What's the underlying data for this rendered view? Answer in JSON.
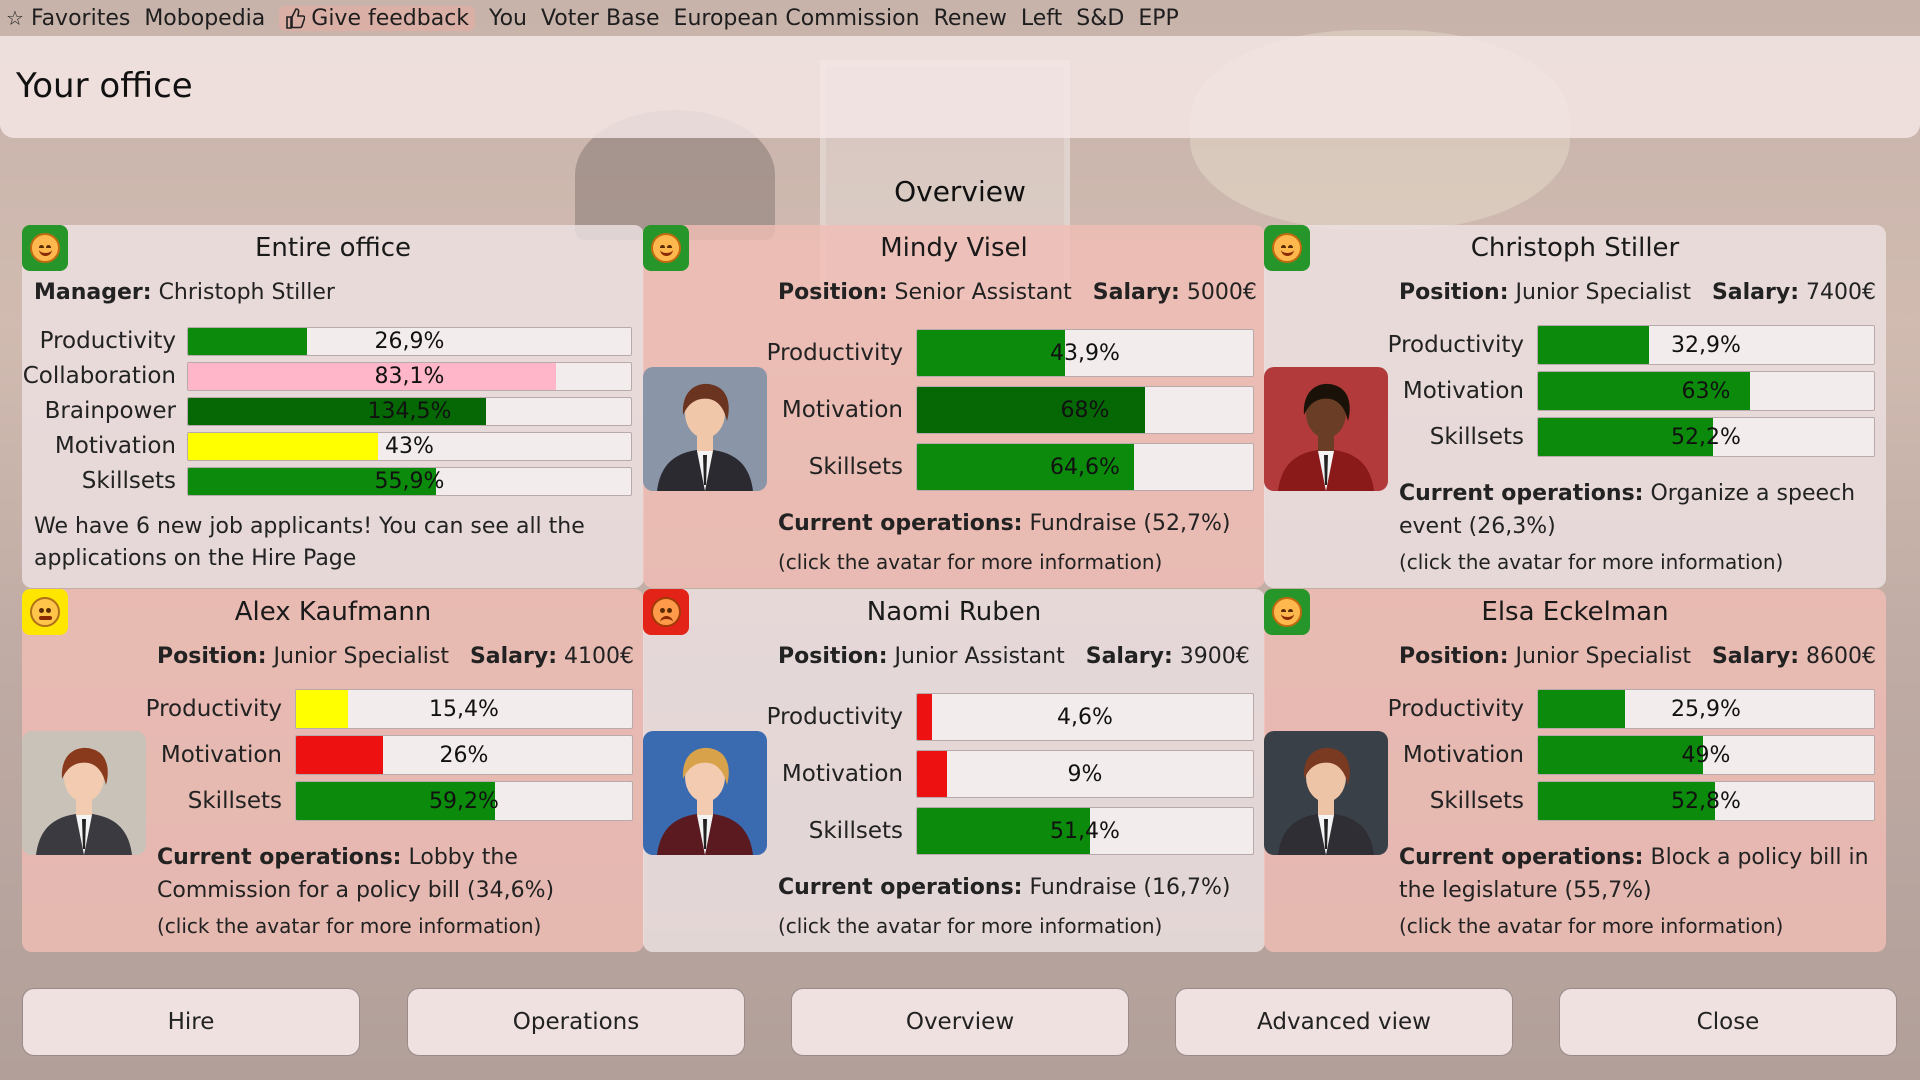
{
  "topbar": {
    "items": [
      "Favorites",
      "Mobopedia",
      "Give feedback",
      "You",
      "Voter Base",
      "European Commission",
      "Renew",
      "Left",
      "S&D",
      "EPP"
    ]
  },
  "title": "Your office",
  "overview_heading": "Overview",
  "colors": {
    "green": "#0b8a0b",
    "dark_green": "#056805",
    "yellow": "#ffff00",
    "red": "#ee1111",
    "pink": "#ffb6c8",
    "mood_green": "#27962a",
    "mood_yellow": "#ffe600",
    "mood_red": "#e32218"
  },
  "office": {
    "name": "Entire office",
    "mood": "happy-face-icon",
    "manager_label": "Manager:",
    "manager": "Christoph Stiller",
    "stats": [
      {
        "label": "Productivity",
        "value": "26,9%",
        "fraction": 0.269,
        "color": "#0b8a0b"
      },
      {
        "label": "Collaboration",
        "value": "83,1%",
        "fraction": 0.831,
        "color": "#ffb6c8"
      },
      {
        "label": "Brainpower",
        "value": "134,5%",
        "fraction": 0.672,
        "color": "#056805"
      },
      {
        "label": "Motivation",
        "value": "43%",
        "fraction": 0.43,
        "color": "#ffff00"
      },
      {
        "label": "Skillsets",
        "value": "55,9%",
        "fraction": 0.559,
        "color": "#0b8a0b"
      }
    ],
    "message": "We have 6 new job applicants! You can see all the applications on the Hire Page"
  },
  "labels": {
    "position": "Position:",
    "salary": "Salary:",
    "current_operations": "Current operations:",
    "hint": "(click the avatar for more information)"
  },
  "employees": [
    {
      "name": "Mindy Visel",
      "mood": "happy-face-icon",
      "position": "Senior Assistant",
      "salary": "5000€",
      "stats": [
        {
          "label": "Productivity",
          "value": "43,9%",
          "fraction": 0.439,
          "color": "#0b8a0b"
        },
        {
          "label": "Motivation",
          "value": "68%",
          "fraction": 0.68,
          "color": "#056805"
        },
        {
          "label": "Skillsets",
          "value": "64,6%",
          "fraction": 0.646,
          "color": "#0b8a0b"
        }
      ],
      "operations": "Fundraise (52,7%)"
    },
    {
      "name": "Christoph Stiller",
      "mood": "happy-face-icon",
      "position": "Junior Specialist",
      "salary": "7400€",
      "stats": [
        {
          "label": "Productivity",
          "value": "32,9%",
          "fraction": 0.329,
          "color": "#0b8a0b"
        },
        {
          "label": "Motivation",
          "value": "63%",
          "fraction": 0.63,
          "color": "#0b8a0b"
        },
        {
          "label": "Skillsets",
          "value": "52,2%",
          "fraction": 0.522,
          "color": "#0b8a0b"
        }
      ],
      "operations": "Organize a speech event (26,3%)"
    },
    {
      "name": "Alex Kaufmann",
      "mood": "neutral-face-icon",
      "position": "Junior Specialist",
      "salary": "4100€",
      "stats": [
        {
          "label": "Productivity",
          "value": "15,4%",
          "fraction": 0.154,
          "color": "#ffff00"
        },
        {
          "label": "Motivation",
          "value": "26%",
          "fraction": 0.26,
          "color": "#ee1111"
        },
        {
          "label": "Skillsets",
          "value": "59,2%",
          "fraction": 0.592,
          "color": "#0b8a0b"
        }
      ],
      "operations": "Lobby the Commission for a policy bill (34,6%)"
    },
    {
      "name": "Naomi Ruben",
      "mood": "sad-face-icon",
      "position": "Junior Assistant",
      "salary": "3900€",
      "stats": [
        {
          "label": "Productivity",
          "value": "4,6%",
          "fraction": 0.046,
          "color": "#ee1111"
        },
        {
          "label": "Motivation",
          "value": "9%",
          "fraction": 0.09,
          "color": "#ee1111"
        },
        {
          "label": "Skillsets",
          "value": "51,4%",
          "fraction": 0.514,
          "color": "#0b8a0b"
        }
      ],
      "operations": "Fundraise (16,7%)"
    },
    {
      "name": "Elsa Eckelman",
      "mood": "happy-face-icon",
      "position": "Junior Specialist",
      "salary": "8600€",
      "stats": [
        {
          "label": "Productivity",
          "value": "25,9%",
          "fraction": 0.259,
          "color": "#0b8a0b"
        },
        {
          "label": "Motivation",
          "value": "49%",
          "fraction": 0.49,
          "color": "#0b8a0b"
        },
        {
          "label": "Skillsets",
          "value": "52,8%",
          "fraction": 0.528,
          "color": "#0b8a0b"
        }
      ],
      "operations": "Block a policy bill in the legislature (55,7%)"
    }
  ],
  "footer": {
    "buttons": [
      "Hire",
      "Operations",
      "Overview",
      "Advanced view",
      "Close"
    ]
  }
}
